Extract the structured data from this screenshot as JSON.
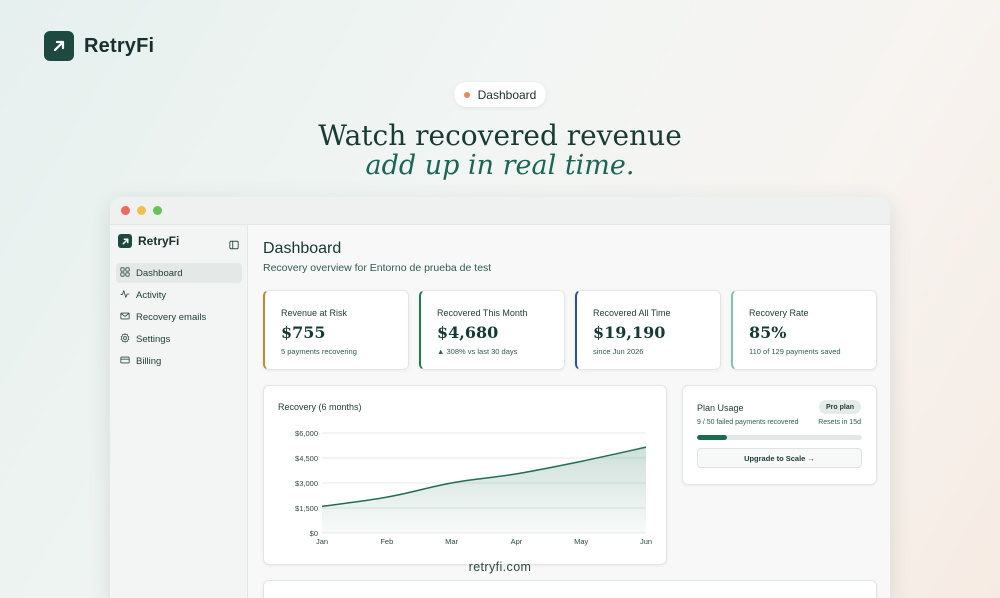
{
  "brand": {
    "name": "RetryFi",
    "logo_icon": "arrow-up-right-icon"
  },
  "hero": {
    "badge": "Dashboard",
    "badge_dot_color": "#e8875e",
    "headline": "Watch recovered revenue",
    "headline_emphasis": "add up in real time."
  },
  "app": {
    "brand": "RetryFi",
    "window_controls": {
      "close": "#ee6a5f",
      "minimize": "#f4be4f",
      "maximize": "#61c454"
    },
    "sidebar": {
      "items": [
        {
          "label": "Dashboard",
          "icon": "dashboard-grid-icon",
          "active": true
        },
        {
          "label": "Activity",
          "icon": "activity-pulse-icon",
          "active": false
        },
        {
          "label": "Recovery emails",
          "icon": "mail-icon",
          "active": false
        },
        {
          "label": "Settings",
          "icon": "gear-icon",
          "active": false
        },
        {
          "label": "Billing",
          "icon": "credit-card-icon",
          "active": false
        }
      ]
    },
    "header": {
      "title": "Dashboard",
      "subtitle": "Recovery overview for Entorno de prueba de test"
    },
    "stats": [
      {
        "label": "Revenue at Risk",
        "value": "$755",
        "note": "5 payments recovering",
        "accent": "#c08a2e"
      },
      {
        "label": "Recovered This Month",
        "value": "$4,680",
        "note": "▲ 308% vs last 30 days",
        "accent": "#1f7a52"
      },
      {
        "label": "Recovered All Time",
        "value": "$19,190",
        "note": "since Jun 2026",
        "accent": "#2a4f9c"
      },
      {
        "label": "Recovery Rate",
        "value": "85%",
        "note": "110 of 129 payments saved",
        "accent": "#7fc2ad"
      }
    ],
    "plan": {
      "title": "Plan Usage",
      "badge": "Pro plan",
      "usage_text": "9 / 50 failed payments recovered",
      "reset_text": "Resets in 15d",
      "used": 9,
      "limit": 50,
      "button": "Upgrade to Scale →"
    }
  },
  "chart_data": {
    "type": "area",
    "title": "Recovery (6 months)",
    "categories": [
      "Jan",
      "Feb",
      "Mar",
      "Apr",
      "May",
      "Jun"
    ],
    "values": [
      1600,
      2150,
      3000,
      3550,
      4300,
      5150
    ],
    "ylim": [
      0,
      6000
    ],
    "yticks": [
      0,
      1500,
      3000,
      4500,
      6000
    ],
    "ytick_labels": [
      "$0",
      "$1,500",
      "$3,000",
      "$4,500",
      "$6,000"
    ],
    "grid": true,
    "color": "#1f6e50"
  },
  "footer": {
    "url": "retryfi.com"
  }
}
